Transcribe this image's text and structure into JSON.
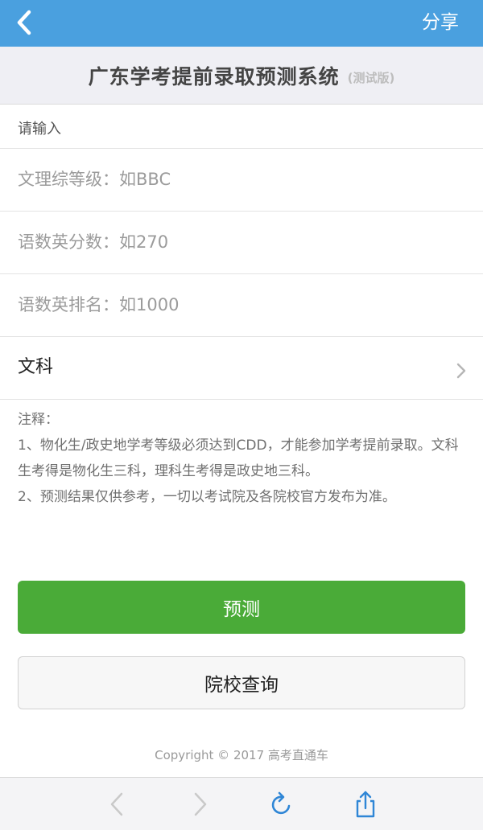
{
  "topbar": {
    "share_label": "分享",
    "back_icon": "chevron-left-icon",
    "bg_color": "#4aa0df"
  },
  "header": {
    "title": "广东学考提前录取预测系统",
    "subtitle": "(测试版)"
  },
  "form": {
    "section_label": "请输入",
    "grade_placeholder": "文理综等级：如BBC",
    "score_placeholder": "语数英分数：如270",
    "rank_placeholder": "语数英排名：如1000",
    "subject_value": "文科"
  },
  "notes": {
    "heading": "注释：",
    "item1": "1、物化生/政史地学考等级必须达到CDD，才能参加学考提前录取。文科生考得是物化生三科，理科生考得是政史地三科。",
    "item2": "2、预测结果仅供参考，一切以考试院及各院校官方发布为准。"
  },
  "buttons": {
    "predict_label": "预测",
    "predict_color": "#4aab38",
    "query_label": "院校查询"
  },
  "footer": {
    "copyright": "Copyright © 2017 高考直通车"
  },
  "toolbar": {
    "icons": [
      "back-arrow-icon",
      "forward-arrow-icon",
      "reload-icon",
      "share-icon"
    ]
  }
}
